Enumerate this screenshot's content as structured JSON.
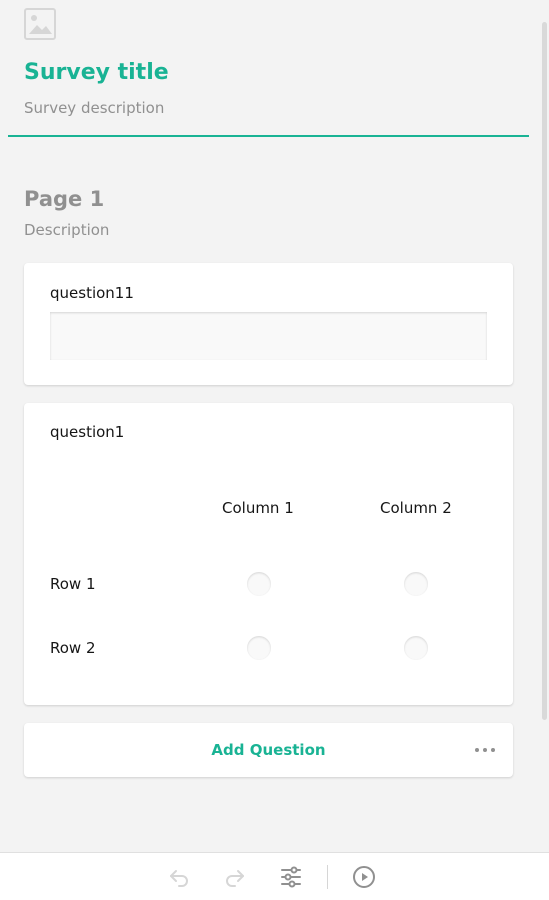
{
  "survey": {
    "title": "Survey title",
    "description": "Survey description"
  },
  "page": {
    "title": "Page 1",
    "description": "Description"
  },
  "questions": [
    {
      "name": "question11",
      "type": "text"
    },
    {
      "name": "question1",
      "type": "matrix",
      "columns": [
        "Column 1",
        "Column 2"
      ],
      "rows": [
        "Row 1",
        "Row 2"
      ]
    }
  ],
  "add_question": {
    "label": "Add Question"
  },
  "toolbar": {
    "buttons": [
      "undo-icon",
      "redo-icon",
      "settings-icon",
      "preview-icon"
    ]
  },
  "colors": {
    "accent": "#19b394",
    "muted_text": "#909090",
    "background": "#f3f3f3"
  }
}
